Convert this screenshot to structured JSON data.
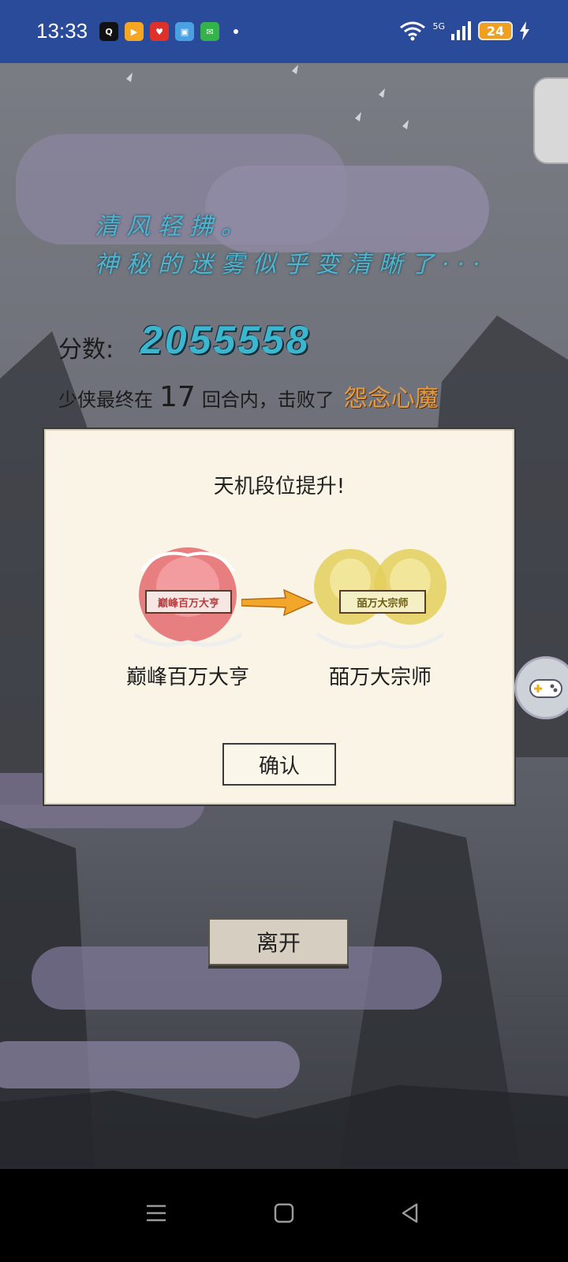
{
  "status_bar": {
    "time": "13:33",
    "network": "5G",
    "battery": "24",
    "apps": [
      {
        "icon": "qq-icon",
        "color": "#111111",
        "text": "Q"
      },
      {
        "icon": "video-app-icon",
        "color": "#f5a623",
        "text": "▶"
      },
      {
        "icon": "lottery-app-icon",
        "color": "#e0302a",
        "text": "♥"
      },
      {
        "icon": "gallery-app-icon",
        "color": "#4aa0e0",
        "text": "▣"
      },
      {
        "icon": "message-app-icon",
        "color": "#35b34a",
        "text": "✉"
      }
    ]
  },
  "poem": {
    "line1": "清风轻拂。",
    "line2": "神秘的迷雾似乎变清晰了···"
  },
  "score": {
    "label": "分数:",
    "value": "2055558"
  },
  "result": {
    "prefix": "少侠最终在",
    "rounds": "17",
    "middle": "回合内，击败了",
    "boss": "怨念心魔"
  },
  "dialog": {
    "title": "天机段位提升!",
    "from_rank": {
      "label": "巅峰百万大亨",
      "plate": "巅峰百万大亨",
      "color": "#d9555a"
    },
    "to_rank": {
      "label": "皕万大宗师",
      "plate": "皕万大宗师",
      "color": "#d8c24a"
    },
    "confirm_label": "确认"
  },
  "leave_label": "离开",
  "colors": {
    "status_bar": "#2a4a9a",
    "score": "#3cb6cf",
    "poem": "#4fb5cf",
    "boss": "#e39a45",
    "dialog_bg": "#faf4e6"
  }
}
